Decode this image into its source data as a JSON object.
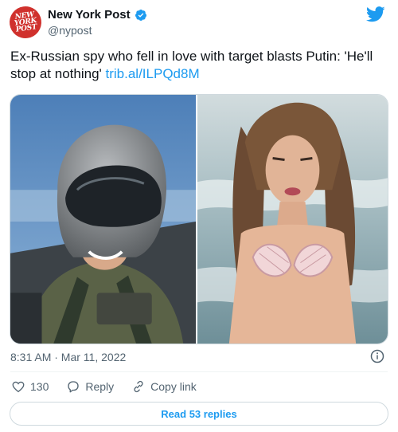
{
  "author": {
    "display_name": "New York Post",
    "handle": "@nypost",
    "avatar_lines": [
      "NEW",
      "YORK",
      "POST"
    ]
  },
  "tweet": {
    "text": "Ex-Russian spy who fell in love with target blasts Putin: 'He'll stop at nothing'",
    "link": "trib.al/ILPQd8M"
  },
  "timestamp": "8:31 AM · Mar 11, 2022",
  "actions": {
    "like_count": "130",
    "reply_label": "Reply",
    "copy_link_label": "Copy link"
  },
  "read_replies_label": "Read 53 replies",
  "colors": {
    "accent": "#1d9bf0",
    "brand_red": "#d0312d",
    "muted": "#536471"
  },
  "icons": [
    "verified-badge-icon",
    "twitter-bird-icon",
    "info-icon",
    "heart-icon",
    "reply-icon",
    "copy-link-icon"
  ]
}
